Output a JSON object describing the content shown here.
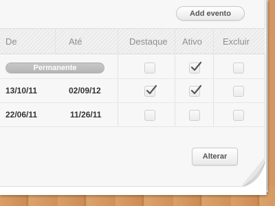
{
  "toolbar": {
    "add_label": "Add evento"
  },
  "table": {
    "headers": [
      "De",
      "Até",
      "Destaque",
      "Ativo",
      "Excluir"
    ],
    "rows": [
      {
        "permanent_label": "Permanente",
        "destaque": false,
        "ativo": true,
        "excluir": false
      },
      {
        "de": "13/10/11",
        "ate": "02/09/12",
        "destaque": true,
        "ativo": true,
        "excluir": false
      },
      {
        "de": "22/06/11",
        "ate": "11/26/11",
        "destaque": false,
        "ativo": false,
        "excluir": false
      }
    ]
  },
  "footer": {
    "alter_label": "Alterar"
  },
  "icons": {
    "check": "check-icon"
  }
}
